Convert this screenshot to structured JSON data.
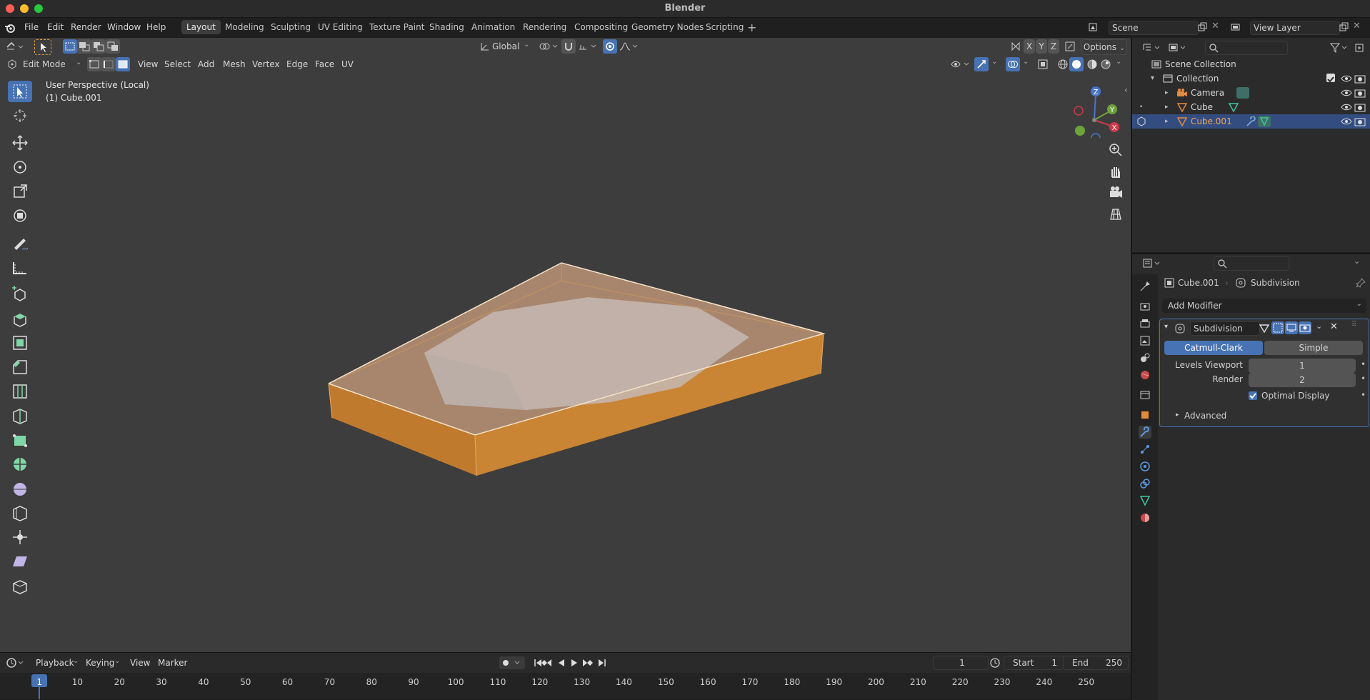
{
  "window": {
    "title": "Blender"
  },
  "menu": {
    "items": [
      "File",
      "Edit",
      "Render",
      "Window",
      "Help"
    ]
  },
  "workspaces": [
    "Layout",
    "Modeling",
    "Sculpting",
    "UV Editing",
    "Texture Paint",
    "Shading",
    "Animation",
    "Rendering",
    "Compositing",
    "Geometry Nodes",
    "Scripting"
  ],
  "active_workspace": "Layout",
  "scene": {
    "name": "Scene",
    "view_layer": "View Layer"
  },
  "viewport": {
    "transform_orientation": "Global",
    "options_label": "Options",
    "axis_buttons": [
      "X",
      "Y",
      "Z"
    ],
    "mode": "Edit Mode",
    "header_menus": [
      "View",
      "Select",
      "Add",
      "Mesh",
      "Vertex",
      "Edge",
      "Face",
      "UV"
    ],
    "info_line1": "User Perspective (Local)",
    "info_line2": "(1) Cube.001",
    "gizmo_labels": {
      "z": "Z",
      "y": "Y",
      "x": "X"
    },
    "colors": {
      "bg": "#3d3d3d",
      "mesh_side": "#c7812f",
      "mesh_top": "#b68b6e",
      "selection": "#e8c07a",
      "inner": "#bfb2ad"
    }
  },
  "outliner": {
    "root": "Scene Collection",
    "collection": "Collection",
    "items": [
      {
        "name": "Camera",
        "icon": "camera-icon",
        "selected": false
      },
      {
        "name": "Cube",
        "icon": "mesh-icon",
        "selected": false
      },
      {
        "name": "Cube.001",
        "icon": "mesh-icon",
        "selected": true
      }
    ]
  },
  "properties": {
    "breadcrumb_object": "Cube.001",
    "breadcrumb_modifier": "Subdivision",
    "add_modifier_label": "Add Modifier",
    "modifier": {
      "name": "Subdivision",
      "type_options": [
        "Catmull-Clark",
        "Simple"
      ],
      "selected_type": "Catmull-Clark",
      "levels_viewport_label": "Levels Viewport",
      "levels_viewport": "1",
      "render_label": "Render",
      "render": "2",
      "optimal_display_label": "Optimal Display",
      "optimal_display": true,
      "advanced_label": "Advanced"
    }
  },
  "timeline": {
    "menus": [
      "Playback",
      "Keying",
      "View",
      "Marker"
    ],
    "current_frame": "1",
    "start_label": "Start",
    "start": "1",
    "end_label": "End",
    "end": "250",
    "ticks": [
      "1",
      "10",
      "20",
      "30",
      "40",
      "50",
      "60",
      "70",
      "80",
      "90",
      "100",
      "110",
      "120",
      "130",
      "140",
      "150",
      "160",
      "170",
      "180",
      "190",
      "200",
      "210",
      "220",
      "230",
      "240",
      "250"
    ]
  }
}
